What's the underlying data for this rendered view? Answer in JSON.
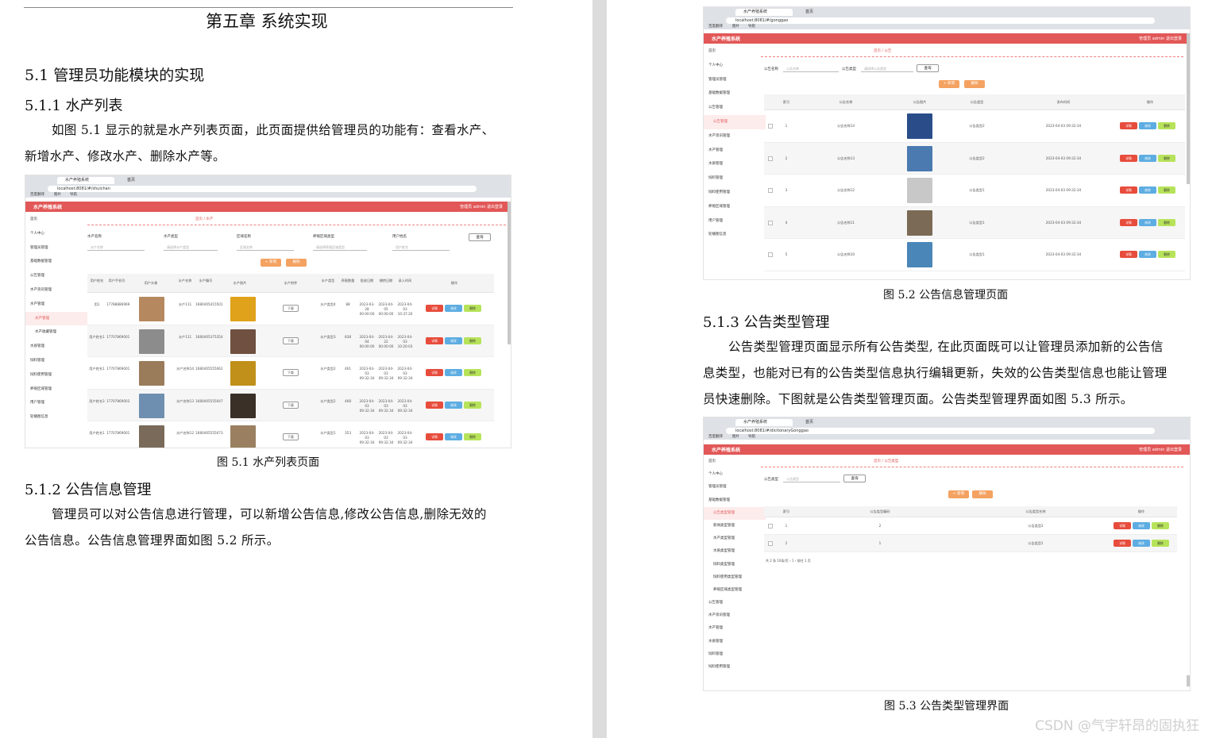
{
  "left": {
    "chapter": "第五章  系统实现",
    "s51": "5.1  管理员功能模块的实现",
    "s511": "5.1.1  水产列表",
    "p1a": "如图 5.1 显示的就是水产列表页面，此页面提供给管理员的功能有：查看水产、",
    "p1b": "新增水产、修改水产、删除水产等。",
    "cap1": "图 5.1  水产列表页面",
    "s512": "5.1.2  公告信息管理",
    "p2a": "管理员可以对公告信息进行管理，可以新增公告信息,修改公告信息,删除无效的",
    "p2b": "公告信息。公告信息管理界面如图 5.2 所示。"
  },
  "right": {
    "cap2": "图 5.2  公告信息管理页面",
    "s513": "5.1.3  公告类型管理",
    "p3a": "公告类型管理页面显示所有公告类型, 在此页面既可以让管理员添加新的公告信",
    "p3b": "息类型，也能对已有的公告类型信息执行编辑更新，失效的公告类型信息也能让管理",
    "p3c": "员快速删除。下图就是公告类型管理页面。公告类型管理界面如图 5.3 所示。",
    "cap3": "图 5.3 公告类型管理界面"
  },
  "app": {
    "title": "水产养殖系统",
    "user": "管理员 admin    退出登录",
    "tab1": "水产养殖系统",
    "tab2": "首页",
    "url1": "localhost:8081/#/shuichan",
    "url2": "localhost:8081/#/gonggao",
    "url3": "localhost:8081/#/dictionaryGonggao",
    "bm1": "百度翻译",
    "bm2": "图片",
    "bm3": "导航",
    "btn_query": "查询",
    "btn_add": "+ 新增",
    "btn_del": "删除",
    "op1": "详情",
    "op2": "修改",
    "op3": "删除"
  },
  "fig1": {
    "crumb": "首页 / 水产",
    "side": [
      "首页",
      "个人中心",
      "管理员管理",
      "基础数据管理",
      "公告管理",
      "水产资讯管理",
      "水产管理",
      "水产管理",
      "水产收藏管理",
      "水质管理",
      "饲料管理",
      "饲料使用管理",
      "养殖区域管理",
      "用户管理",
      "轮播图信息"
    ],
    "filters": [
      "水产名称",
      "水产类型",
      "区域名称",
      "养殖区域类型",
      "用户姓名"
    ],
    "placeholders": [
      "水产名称",
      "请选择水产类型",
      "区域名称",
      "请选择养殖区域类型",
      "用户姓名"
    ],
    "headers": [
      "用户姓名",
      "用户手机号",
      "用户头像",
      "水产名称",
      "水产编号",
      "水产照片",
      "水产附件",
      "水产类型",
      "养殖数量",
      "投放日期",
      "捕捞日期",
      "录入时间",
      "操作"
    ],
    "rows": [
      [
        "用1",
        "17788886969",
        "",
        "水产111",
        "1680405415501",
        "",
        "下载",
        "水产类型4",
        "88",
        "2023-03-28 00:00:00",
        "2023-04-05 00:00:00",
        "2023-04-03 10:37:20"
      ],
      [
        "用户姓名1",
        "17707869001",
        "",
        "水产111",
        "1680405375354",
        "",
        "下载",
        "水产类型3",
        "838",
        "2023-04-04 00:00:00",
        "2023-04-22 00:00:00",
        "2023-04-03 10:20:03"
      ],
      [
        "用户姓名1",
        "17707869001",
        "",
        "水产名称14",
        "1680405555062",
        "",
        "下载",
        "水产类型2",
        "461",
        "2023-04-03 09:32:34",
        "2023-04-03 09:32:34",
        "2023-04-03 09:32:34"
      ],
      [
        "用户姓名3",
        "17707869003",
        "",
        "水产名称13",
        "1680405555047",
        "",
        "下载",
        "水产类型2",
        "468",
        "2023-04-03 09:32:34",
        "2023-04-03 09:32:34",
        "2023-04-03 09:32:34"
      ],
      [
        "用户姓名1",
        "17707869001",
        "",
        "水产名称12",
        "1680405555073",
        "",
        "下载",
        "水产类型1",
        "353",
        "2023-04-03 09:32:34",
        "2023-04-03 09:32:34",
        "2023-04-03 09:32:34"
      ]
    ]
  },
  "fig2": {
    "crumb": "首页 / 公告",
    "side": [
      "首页",
      "个人中心",
      "管理员管理",
      "基础数据管理",
      "公告管理",
      "公告管理",
      "水产资讯管理",
      "水产管理",
      "水质管理",
      "饲料管理",
      "饲料使用管理",
      "养殖区域管理",
      "用户管理",
      "轮播图信息"
    ],
    "filters": [
      "公告名称",
      "公告类型"
    ],
    "placeholders": [
      "公告名称",
      "请选择公告类型"
    ],
    "headers": [
      "",
      "索引",
      "公告名称",
      "公告图片",
      "公告类型",
      "发布时间",
      "操作"
    ],
    "rows": [
      [
        "1",
        "公告名称14",
        "",
        "公告类型2",
        "2023-04-03 09:32:34"
      ],
      [
        "2",
        "公告名称13",
        "",
        "公告类型2",
        "2023-04-03 09:32:34"
      ],
      [
        "3",
        "公告名称12",
        "",
        "公告类型1",
        "2023-04-03 09:32:34"
      ],
      [
        "4",
        "公告名称11",
        "",
        "公告类型1",
        "2023-04-03 09:32:34"
      ],
      [
        "5",
        "公告名称10",
        "",
        "公告类型1",
        "2023-04-03 09:32:34"
      ]
    ]
  },
  "fig3": {
    "crumb": "首页 / 公告类型",
    "side": [
      "首页",
      "个人中心",
      "管理员管理",
      "基础数据管理",
      "公告类型管理",
      "新闻类型管理",
      "水产类型管理",
      "水质类型管理",
      "饲料类型管理",
      "饲料使用类型管理",
      "养殖区域类型管理",
      "公告管理",
      "水产资讯管理",
      "水产管理",
      "水质管理",
      "饲料管理",
      "饲料使用管理"
    ],
    "filter": "公告类型",
    "placeholder": "公告类型",
    "headers": [
      "",
      "索引",
      "公告类型编码",
      "公告类型名称",
      "操作"
    ],
    "rows": [
      [
        "1",
        "2",
        "公告类型2"
      ],
      [
        "2",
        "1",
        "公告类型1"
      ]
    ],
    "pager": "共 2 条    10条/页    ‹  1  ›    前往  1  页"
  },
  "watermark": "CSDN @气宇轩昂的固执狂"
}
